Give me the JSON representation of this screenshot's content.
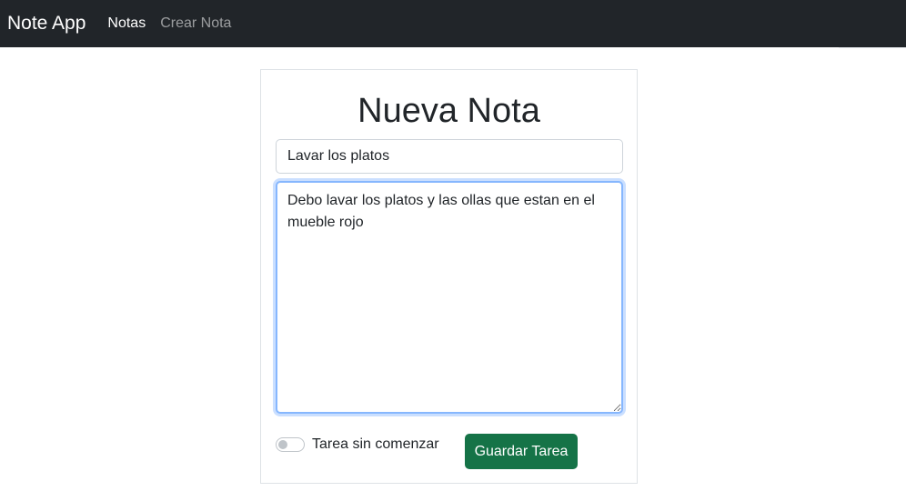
{
  "navbar": {
    "brand": "Note App",
    "links": [
      {
        "label": "Notas",
        "active": true
      },
      {
        "label": "Crear Nota",
        "active": false
      }
    ],
    "background": "#212529"
  },
  "form": {
    "heading": "Nueva Nota",
    "title_value": "Lavar los platos",
    "description_value": "Debo lavar los platos y las ollas que estan en el mueble rojo",
    "status_toggle": {
      "label": "Tarea sin comenzar",
      "checked": false
    },
    "save_label": "Guardar Tarea",
    "save_color": "#157347",
    "focus_color": "#86b7fe"
  }
}
